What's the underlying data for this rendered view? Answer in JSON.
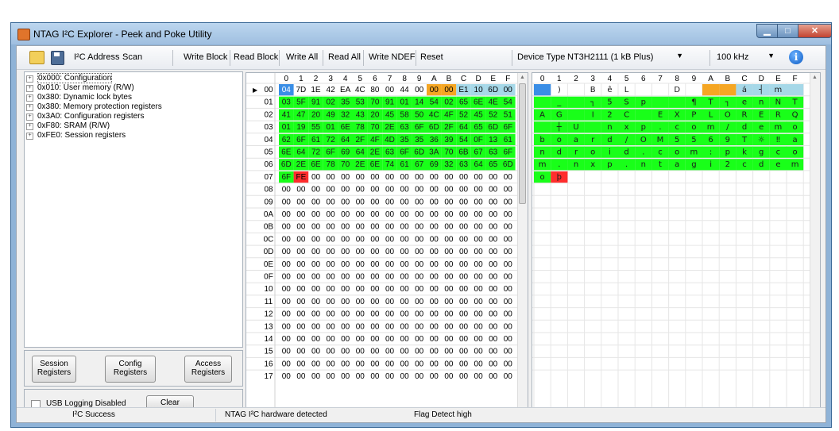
{
  "window": {
    "title": "NTAG I²C Explorer - Peek and Poke Utility"
  },
  "toolbar": {
    "i2c_address_label": "I²C Address",
    "scan_label": "Scan",
    "write_block_label": "Write Block",
    "read_block_label": "Read Block",
    "write_all_label": "Write All",
    "read_all_label": "Read All",
    "write_ndef_label": "Write NDEF",
    "reset_label": "Reset",
    "device_type_label": "Device Type",
    "device_type_value": "NT3H2111 (1 kB Plus)",
    "speed_value": "100 kHz"
  },
  "tree": [
    "0x000: Configuration",
    "0x010: User memory (R/W)",
    "0x380: Dynamic lock bytes",
    "0x380: Memory protection registers",
    "0x3A0: Configuration registers",
    "0xF80: SRAM (R/W)",
    "0xFE0: Session registers"
  ],
  "buttons": {
    "session_registers": "Session Registers",
    "config_registers": "Config Registers",
    "access_registers": "Access Registers",
    "usb_logging_label": "USB Logging Disabled",
    "clear_label": "Clear"
  },
  "grid": {
    "headers": [
      "0",
      "1",
      "2",
      "3",
      "4",
      "5",
      "6",
      "7",
      "8",
      "9",
      "A",
      "B",
      "C",
      "D",
      "E",
      "F"
    ],
    "row_labels": [
      "00",
      "01",
      "02",
      "03",
      "04",
      "05",
      "06",
      "07",
      "08",
      "09",
      "0A",
      "0B",
      "0C",
      "0D",
      "0E",
      "0F",
      "10",
      "11",
      "12",
      "13",
      "14",
      "15",
      "16",
      "17"
    ],
    "hex": [
      [
        "04",
        "7D",
        "1E",
        "42",
        "EA",
        "4C",
        "80",
        "00",
        "44",
        "00",
        "00",
        "00",
        "E1",
        "10",
        "6D",
        "00"
      ],
      [
        "03",
        "5F",
        "91",
        "02",
        "35",
        "53",
        "70",
        "91",
        "01",
        "14",
        "54",
        "02",
        "65",
        "6E",
        "4E",
        "54"
      ],
      [
        "41",
        "47",
        "20",
        "49",
        "32",
        "43",
        "20",
        "45",
        "58",
        "50",
        "4C",
        "4F",
        "52",
        "45",
        "52",
        "51"
      ],
      [
        "01",
        "19",
        "55",
        "01",
        "6E",
        "78",
        "70",
        "2E",
        "63",
        "6F",
        "6D",
        "2F",
        "64",
        "65",
        "6D",
        "6F"
      ],
      [
        "62",
        "6F",
        "61",
        "72",
        "64",
        "2F",
        "4F",
        "4D",
        "35",
        "35",
        "36",
        "39",
        "54",
        "0F",
        "13",
        "61"
      ],
      [
        "6E",
        "64",
        "72",
        "6F",
        "69",
        "64",
        "2E",
        "63",
        "6F",
        "6D",
        "3A",
        "70",
        "6B",
        "67",
        "63",
        "6F"
      ],
      [
        "6D",
        "2E",
        "6E",
        "78",
        "70",
        "2E",
        "6E",
        "74",
        "61",
        "67",
        "69",
        "32",
        "63",
        "64",
        "65",
        "6D"
      ],
      [
        "6F",
        "FE",
        "00",
        "00",
        "00",
        "00",
        "00",
        "00",
        "00",
        "00",
        "00",
        "00",
        "00",
        "00",
        "00",
        "00"
      ]
    ],
    "empty_row_value": "00",
    "ascii": [
      [
        "",
        ")",
        "",
        "B",
        "ê",
        "L",
        "",
        "",
        "D",
        "",
        "",
        "",
        "á",
        "┤",
        "m",
        ""
      ],
      [
        "",
        "_",
        "",
        "┐",
        "5",
        "S",
        "p",
        "",
        "",
        "¶",
        "T",
        "┐",
        "e",
        "n",
        "N",
        "T"
      ],
      [
        "A",
        "G",
        "",
        "I",
        "2",
        "C",
        "",
        "E",
        "X",
        "P",
        "L",
        "O",
        "R",
        "E",
        "R",
        "Q"
      ],
      [
        "",
        "┼",
        "U",
        "",
        "n",
        "x",
        "p",
        ".",
        "c",
        "o",
        "m",
        "/",
        "d",
        "e",
        "m",
        "o"
      ],
      [
        "b",
        "o",
        "a",
        "r",
        "d",
        "/",
        "O",
        "M",
        "5",
        "5",
        "6",
        "9",
        "T",
        "☼",
        "‼",
        "a"
      ],
      [
        "n",
        "d",
        "r",
        "o",
        "i",
        "d",
        ".",
        "c",
        "o",
        "m",
        ":",
        "p",
        "k",
        "g",
        "c",
        "o"
      ],
      [
        "m",
        ".",
        "n",
        "x",
        "p",
        ".",
        "n",
        "t",
        "a",
        "g",
        "i",
        "2",
        "c",
        "d",
        "e",
        "m"
      ],
      [
        "o",
        "þ",
        "",
        "",
        "",
        "",
        "",
        "",
        "",
        "",
        "",
        "",
        "",
        "",
        "",
        ""
      ]
    ],
    "colors": {
      "blue": "#3a8ee6",
      "orange": "#f5a623",
      "cyan": "#a6d8e8",
      "green": "#19ff19",
      "red": "#ff2d2d",
      "header": "#ffffff"
    }
  },
  "status": {
    "left": "I²C Success",
    "middle": "NTAG I²C hardware detected",
    "right": "Flag Detect high"
  }
}
